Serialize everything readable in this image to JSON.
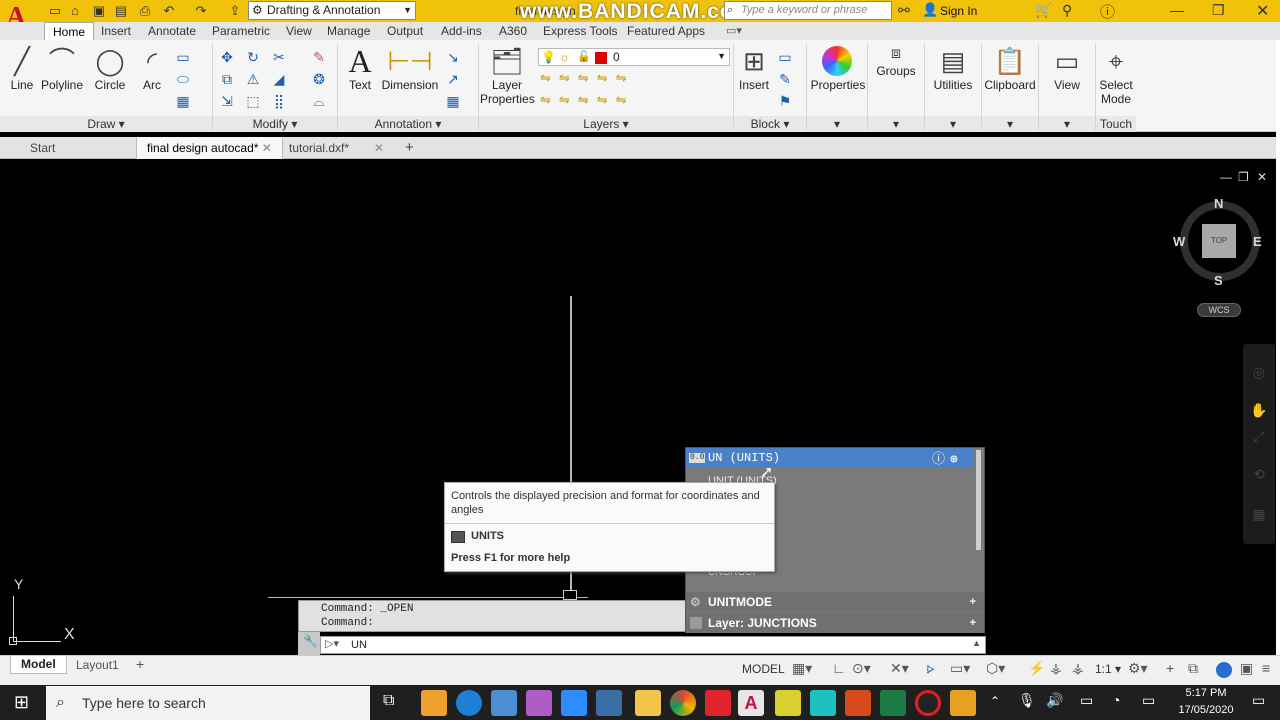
{
  "titlebar": {
    "workspace": "Drafting & Annotation",
    "file_title": "final design",
    "search_placeholder": "Type a keyword or phrase",
    "signin": "Sign In",
    "watermark": "www.BANDICAM.com"
  },
  "ribbon_tabs": [
    "Home",
    "Insert",
    "Annotate",
    "Parametric",
    "View",
    "Manage",
    "Output",
    "Add-ins",
    "A360",
    "Express Tools",
    "Featured Apps"
  ],
  "ribbon": {
    "draw": {
      "tools": [
        "Line",
        "Polyline",
        "Circle",
        "Arc"
      ],
      "title": "Draw"
    },
    "modify": {
      "title": "Modify"
    },
    "annotation": {
      "tools": [
        "Text",
        "Dimension"
      ],
      "title": "Annotation"
    },
    "layers": {
      "tool": "Layer Properties",
      "current_layer": "0",
      "title": "Layers"
    },
    "block": {
      "tool": "Insert",
      "title": "Block"
    },
    "properties": "Properties",
    "groups": "Groups",
    "utilities": "Utilities",
    "clipboard": "Clipboard",
    "view": "View",
    "select_mode": "Select Mode",
    "touch": "Touch"
  },
  "doc_tabs": [
    "Start",
    "final design autocad*",
    "tutorial.dxf*"
  ],
  "viewcube": {
    "n": "N",
    "s": "S",
    "e": "E",
    "w": "W",
    "face": "TOP",
    "wcs": "WCS"
  },
  "ucs": {
    "x": "X",
    "y": "Y"
  },
  "command": {
    "history": [
      "Command:  _OPEN",
      "Command:"
    ],
    "input": "UN"
  },
  "autocomplete": {
    "header": "UN (UNITS)",
    "items": [
      "UNIT (UNITS)",
      "N)",
      "UNGROUP"
    ],
    "rows": [
      "UNITMODE",
      "Layer: JUNCTIONS"
    ]
  },
  "tooltip": {
    "description": "Controls the displayed precision and format for coordinates and angles",
    "command": "UNITS",
    "help": "Press F1 for more help"
  },
  "layout_tabs": [
    "Model",
    "Layout1"
  ],
  "status": {
    "mode": "MODEL",
    "scale": "1:1"
  },
  "taskbar": {
    "search_placeholder": "Type here to search",
    "time": "5:17 PM",
    "date": "17/05/2020"
  }
}
